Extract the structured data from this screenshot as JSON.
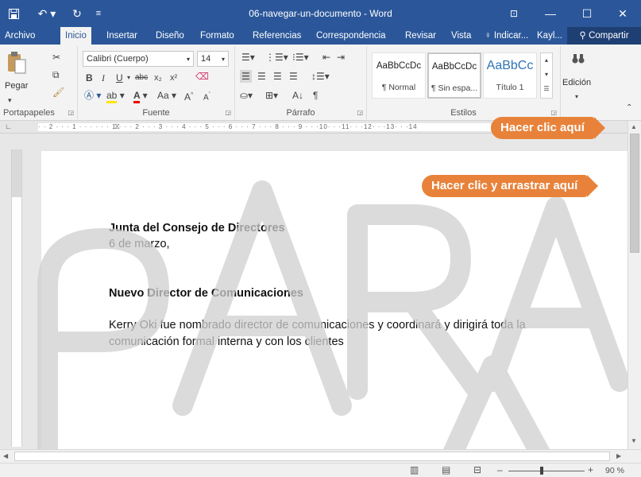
{
  "window": {
    "title": "06-navegar-un-documento  -  Word",
    "buttons": {
      "minimize": "—",
      "maximize": "☐",
      "close": "✕"
    }
  },
  "quick_access": {
    "save_icon": "save-icon",
    "undo_icon": "undo-icon",
    "redo_icon": "redo-icon",
    "customize_icon": "customize-icon"
  },
  "ribbon_display_icon": "ribbon-display-options-icon",
  "tabs": [
    "Archivo",
    "Inicio",
    "Insertar",
    "Diseño",
    "Formato",
    "Referencias",
    "Correspondencia",
    "Revisar",
    "Vista"
  ],
  "active_tab": "Inicio",
  "tell_me": "Indicar...",
  "user": "Kayl...",
  "share_label": "Compartir",
  "ribbon": {
    "clipboard": {
      "label": "Portapapeles",
      "paste": "Pegar"
    },
    "font": {
      "label": "Fuente",
      "font_name": "Calibri (Cuerpo)",
      "font_size": "14",
      "case_label": "Aa"
    },
    "paragraph": {
      "label": "Párrafo"
    },
    "styles": {
      "label": "Estilos",
      "items": [
        {
          "preview": "AaBbCcDc",
          "name": "¶ Normal"
        },
        {
          "preview": "AaBbCcDc",
          "name": "¶ Sin espa..."
        },
        {
          "preview": "AaBbCc",
          "name": "Título 1"
        }
      ]
    },
    "editing": {
      "label": "Edición"
    }
  },
  "ruler": {
    "marks": "· · 2 · · · 1 · · · · · · 1 · · · 2 · · · 3 · · · 4 · · · 5 · · · 6 · · · 7 · · · 8 · · · 9 · · ·10· · ·11· · ·12· · ·13· · ·14"
  },
  "callouts": {
    "top": "Hacer clic aquí",
    "scroll": "Hacer clic y arrastrar aquí"
  },
  "document": {
    "line1": "Junta del Consejo de Directores",
    "line2": "6 de marzo,",
    "heading": "Nuevo Director de Comunicaciones",
    "body1": "Kerry Oki fue nombrado director de comunicaciones y coordinará y dirigirá toda la",
    "body2": "comunicación formal interna y con los clientes"
  },
  "watermark_text": "PARA EVALUACIÓN",
  "status": {
    "zoom": "90 %"
  }
}
